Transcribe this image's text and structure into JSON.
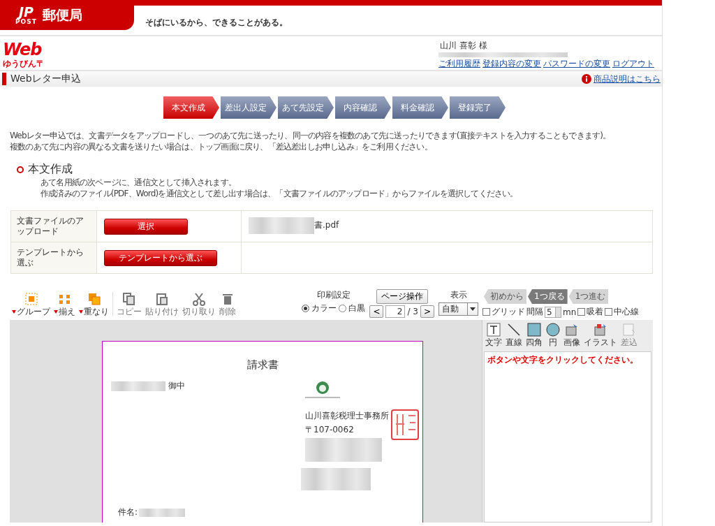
{
  "header": {
    "logo_letters": "JP",
    "logo_sub": "POST",
    "brand": "郵便局",
    "tagline": "そばにいるから、できることがある。"
  },
  "service_logo": {
    "main": "Web",
    "sub": "ゆうびん〒"
  },
  "user": {
    "name": "山川 喜彰 様",
    "links": [
      "ご利用履歴",
      "登録内容の変更",
      "パスワードの変更",
      "ログアウト"
    ]
  },
  "page_title": "Webレター申込",
  "help_link": "商品説明はこちら",
  "steps": [
    {
      "label": "本文作成",
      "selected": true
    },
    {
      "label": "差出人設定",
      "selected": false
    },
    {
      "label": "あて先設定",
      "selected": false
    },
    {
      "label": "内容確認",
      "selected": false
    },
    {
      "label": "料金確認",
      "selected": false
    },
    {
      "label": "登録完了",
      "selected": false
    }
  ],
  "intro": [
    "Webレター申込では、文書データをアップロードし、一つのあて先に送ったり、同一の内容を複数のあて先に送ったりできます(直接テキストを入力することもできます)。",
    "複数のあて先に内容の異なる文書を送りたい場合は、トップ画面に戻り、「差込差出しお申し込み」をご利用ください。"
  ],
  "section": {
    "heading": "本文作成",
    "notes": [
      "あて名用紙の次ページに、通信文として挿入されます。",
      "作成済みのファイル(PDF、Word)を通信文として差し出す場合は、「文書ファイルのアップロード」からファイルを選択してください。"
    ]
  },
  "form_rows": [
    {
      "label": "文書ファイルのアップロード",
      "button": "選択",
      "file_name": "書.pdf"
    },
    {
      "label": "テンプレートから選ぶ",
      "button": "テンプレートから選ぶ"
    }
  ],
  "toolbar": {
    "arrange_tools": [
      {
        "kind": "group",
        "label": "グループ"
      },
      {
        "kind": "align",
        "label": "揃え"
      },
      {
        "kind": "overlap",
        "label": "重なり"
      }
    ],
    "edit_tools": [
      {
        "kind": "copy",
        "label": "コピー",
        "disabled": true
      },
      {
        "kind": "paste",
        "label": "貼り付け",
        "disabled": true
      },
      {
        "kind": "cut",
        "label": "切り取り",
        "disabled": true
      },
      {
        "kind": "delete",
        "label": "削除",
        "disabled": true
      }
    ],
    "print": {
      "label": "印刷設定",
      "options": [
        {
          "label": "カラー",
          "selected": true
        },
        {
          "label": "白黒",
          "selected": false
        }
      ]
    },
    "page_button": "ページ操作",
    "prev": "<",
    "page": "2",
    "total": "/ 3",
    "next": ">",
    "display": {
      "label": "表示",
      "value": "自動"
    },
    "history": [
      {
        "label": "初めから",
        "disabled": true
      },
      {
        "label": "1つ戻る",
        "disabled": false
      },
      {
        "label": "1つ進む",
        "disabled": true
      }
    ],
    "grid": {
      "label": "グリッド",
      "checked": false
    },
    "spacing": {
      "label": "間隔",
      "value": "5",
      "unit": "mn"
    },
    "options": [
      {
        "label": "吸着",
        "checked": false
      },
      {
        "label": "中心線",
        "checked": false
      }
    ]
  },
  "shape_tools": [
    {
      "kind": "text",
      "label": "文字",
      "disabled": false
    },
    {
      "kind": "line",
      "label": "直線",
      "disabled": false
    },
    {
      "kind": "rect",
      "label": "四角",
      "disabled": false
    },
    {
      "kind": "circle",
      "label": "円",
      "disabled": false
    },
    {
      "kind": "image",
      "label": "画像",
      "disabled": false
    },
    {
      "kind": "illust",
      "label": "イラスト",
      "disabled": false
    },
    {
      "kind": "insert",
      "label": "差込",
      "disabled": true
    }
  ],
  "hint": "ボタンや文字をクリックしてください。",
  "document": {
    "title": "請求書",
    "addressee_suffix": "御中",
    "sender": "山川喜彰税理士事務所",
    "postal": "〒107-0062",
    "subject_label": "件名:"
  }
}
